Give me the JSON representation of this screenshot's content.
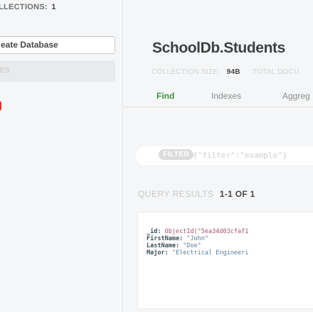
{
  "sidebar": {
    "collections_label": "LLECTIONS:",
    "collections_count": "1",
    "create_button": "eate Database",
    "filter_placeholder": "ES"
  },
  "header": {
    "title": "SchoolDb.Students",
    "stats": [
      {
        "label": "COLLECTION SIZE:",
        "value": "94B"
      },
      {
        "label": "TOTAL DOCU",
        "value": ""
      }
    ]
  },
  "tabs": [
    {
      "label": "Find",
      "active": true
    },
    {
      "label": "Indexes",
      "active": false
    },
    {
      "label": "Aggreg",
      "active": false
    }
  ],
  "filter": {
    "pill": "FILTER",
    "placeholder": "{\"filter\":\"example\"}"
  },
  "results": {
    "label": "QUERY RESULTS",
    "range": "1-1 OF 1"
  },
  "document": {
    "fields": [
      {
        "key": "_id:",
        "value": "ObjectId(\"5ea34d03cfaf1"
      },
      {
        "key": "FirstName:",
        "value": "\"John\""
      },
      {
        "key": "LastName:",
        "value": "\"Doe\""
      },
      {
        "key": "Major:",
        "value": "\"Electrical Engineeri"
      }
    ]
  },
  "colors": {
    "accent_green": "#3f9342",
    "status_red": "#ff2a2a"
  }
}
